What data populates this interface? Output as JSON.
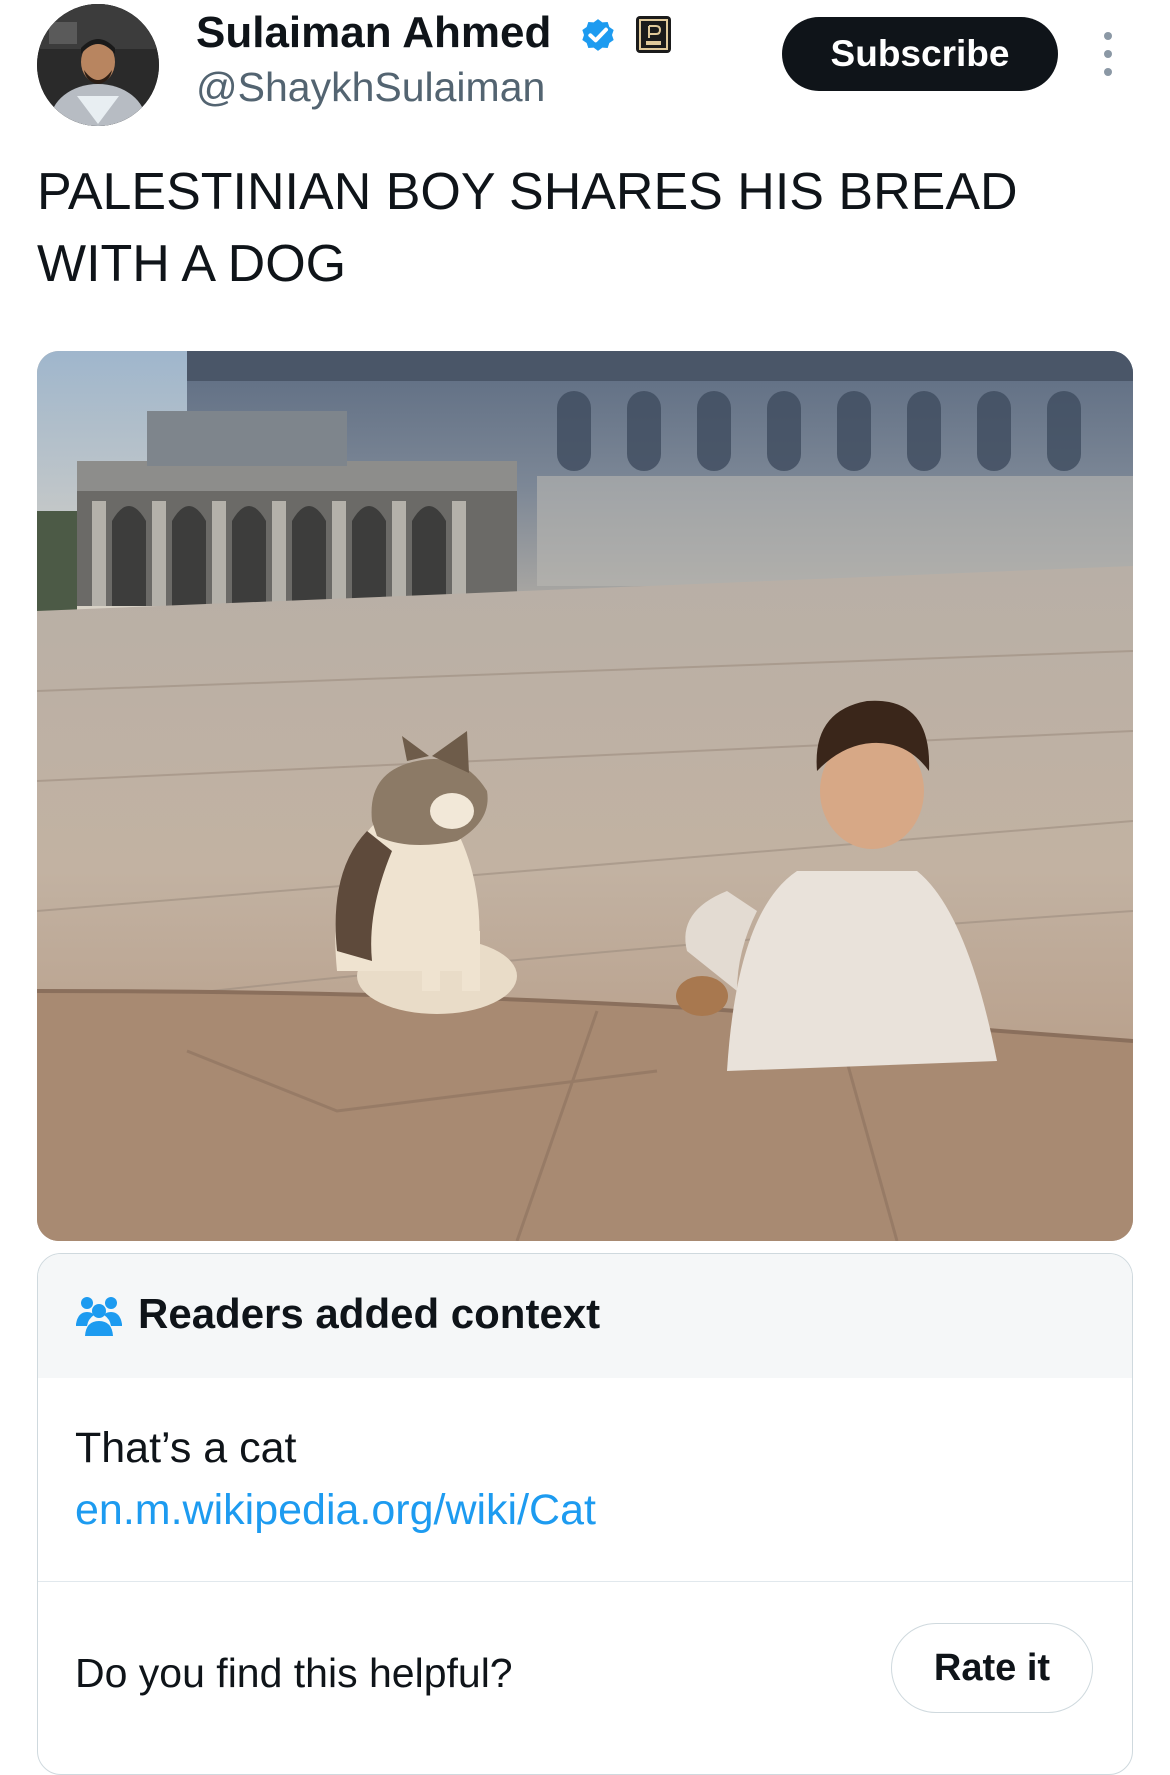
{
  "author": {
    "display_name": "Sulaiman Ahmed",
    "handle": "@ShaykhSulaiman",
    "avatar_icon": "avatar-photo",
    "verified_icon": "verified-badge-icon",
    "affiliate_icon": "affiliate-badge-icon"
  },
  "actions": {
    "subscribe_label": "Subscribe",
    "more_icon": "more-vertical-icon"
  },
  "tweet": {
    "text": "PALESTINIAN BOY SHARES HIS BREAD WITH A DOG",
    "media_description_icon": "video-still"
  },
  "community_note": {
    "icon": "people-icon",
    "title": "Readers added context",
    "body": "That’s a cat",
    "link": "en.m.wikipedia.org/wiki/Cat",
    "helpful_question": "Do you find this helpful?",
    "rate_label": "Rate it"
  },
  "colors": {
    "text_primary": "#0f1419",
    "text_secondary": "#536471",
    "link": "#1d9bf0",
    "verified": "#1d9bf0",
    "subscribe_bg": "#0f1419",
    "note_header_bg": "#f5f7f8",
    "border": "#cfd9de"
  }
}
